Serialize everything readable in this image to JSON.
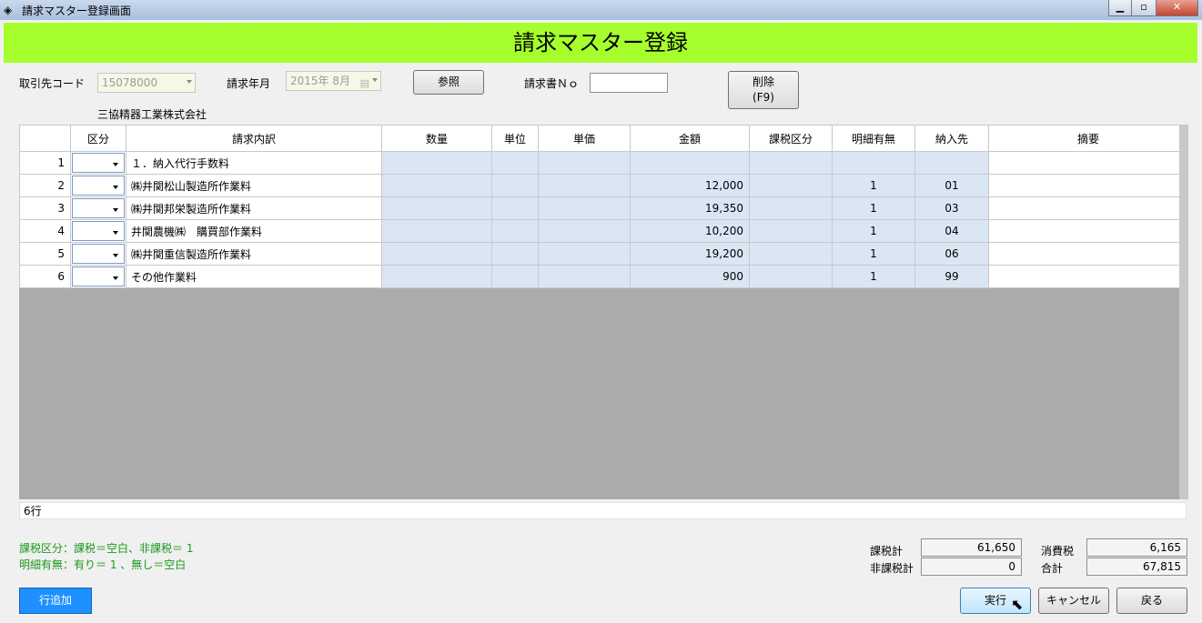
{
  "window": {
    "title": "請求マスター登録画面"
  },
  "header": {
    "title": "請求マスター登録"
  },
  "form": {
    "client_code_label": "取引先コード",
    "client_code_value": "15078000",
    "client_name": "三協精器工業株式会社",
    "billing_month_label": "請求年月",
    "billing_month_value": "2015年  8月",
    "reference_button": "参照",
    "invoice_no_label": "請求書Ｎｏ",
    "invoice_no_value": "",
    "delete_button": "削除",
    "delete_button_key": "(F9)"
  },
  "grid": {
    "columns": [
      "区分",
      "請求内訳",
      "数量",
      "単位",
      "単価",
      "金額",
      "課税区分",
      "明細有無",
      "納入先",
      "摘要"
    ],
    "rows": [
      {
        "no": "1",
        "kubun": "",
        "desc": "１．納入代行手数料",
        "qty": "",
        "unit": "",
        "price": "",
        "amount": "",
        "tax": "",
        "detail": "",
        "dest": "",
        "memo": ""
      },
      {
        "no": "2",
        "kubun": "",
        "desc": "㈱井関松山製造所作業料",
        "qty": "",
        "unit": "",
        "price": "",
        "amount": "12,000",
        "tax": "",
        "detail": "1",
        "dest": "01",
        "memo": ""
      },
      {
        "no": "3",
        "kubun": "",
        "desc": "㈱井関邦栄製造所作業料",
        "qty": "",
        "unit": "",
        "price": "",
        "amount": "19,350",
        "tax": "",
        "detail": "1",
        "dest": "03",
        "memo": ""
      },
      {
        "no": "4",
        "kubun": "",
        "desc": "井関農機㈱　購買部作業料",
        "qty": "",
        "unit": "",
        "price": "",
        "amount": "10,200",
        "tax": "",
        "detail": "1",
        "dest": "04",
        "memo": ""
      },
      {
        "no": "5",
        "kubun": "",
        "desc": "㈱井関重信製造所作業料",
        "qty": "",
        "unit": "",
        "price": "",
        "amount": "19,200",
        "tax": "",
        "detail": "1",
        "dest": "06",
        "memo": ""
      },
      {
        "no": "6",
        "kubun": "",
        "desc": "その他作業料",
        "qty": "",
        "unit": "",
        "price": "",
        "amount": "900",
        "tax": "",
        "detail": "1",
        "dest": "99",
        "memo": ""
      }
    ]
  },
  "status": {
    "row_count": "6行"
  },
  "notes": {
    "line1": "課税区分：課税＝空白、非課税＝ 1",
    "line2": "明細有無：有り＝ 1 、無し＝空白"
  },
  "totals": {
    "taxable_label": "課税計",
    "taxable_value": "61,650",
    "nontaxable_label": "非課税計",
    "nontaxable_value": "0",
    "tax_label": "消費税",
    "tax_value": "6,165",
    "total_label": "合計",
    "total_value": "67,815"
  },
  "buttons": {
    "add_row": "行追加",
    "execute": "実行",
    "cancel": "キャンセル",
    "back": "戻る"
  },
  "colors": {
    "header_band": "#a6ff2c",
    "note_text": "#1a9a1a",
    "add_row_button": "#1e90ff"
  }
}
